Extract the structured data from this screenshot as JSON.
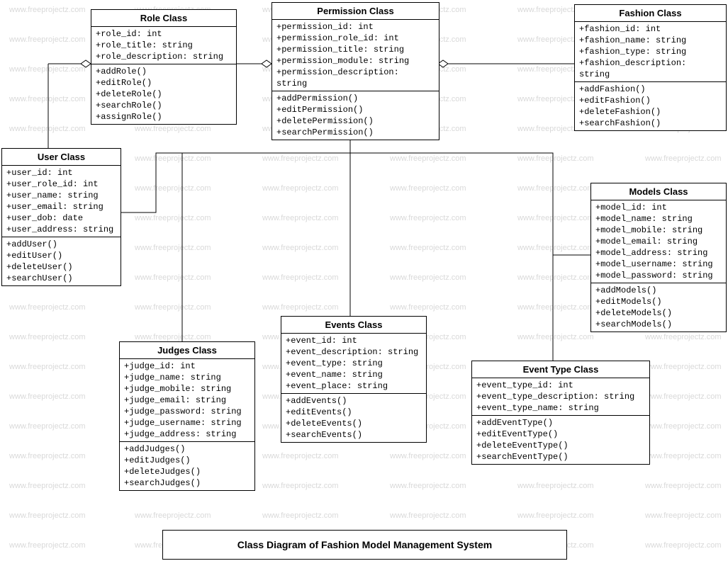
{
  "watermark_text": "www.freeprojectz.com",
  "diagram_title": "Class Diagram of Fashion Model Management System",
  "classes": {
    "role": {
      "title": "Role Class",
      "attrs": [
        "+role_id: int",
        "+role_title: string",
        "+role_description: string"
      ],
      "ops": [
        "+addRole()",
        "+editRole()",
        "+deleteRole()",
        "+searchRole()",
        "+assignRole()"
      ]
    },
    "permission": {
      "title": "Permission Class",
      "attrs": [
        "+permission_id: int",
        "+permission_role_id: int",
        "+permission_title: string",
        "+permission_module: string",
        "+permission_description: string"
      ],
      "ops": [
        "+addPermission()",
        "+editPermission()",
        "+deletePermission()",
        "+searchPermission()"
      ]
    },
    "fashion": {
      "title": "Fashion Class",
      "attrs": [
        "+fashion_id: int",
        "+fashion_name: string",
        "+fashion_type: string",
        "+fashion_description: string"
      ],
      "ops": [
        "+addFashion()",
        "+editFashion()",
        "+deleteFashion()",
        "+searchFashion()"
      ]
    },
    "user": {
      "title": "User Class",
      "attrs": [
        "+user_id: int",
        "+user_role_id: int",
        "+user_name: string",
        "+user_email: string",
        "+user_dob: date",
        "+user_address: string"
      ],
      "ops": [
        "+addUser()",
        "+editUser()",
        "+deleteUser()",
        "+searchUser()"
      ]
    },
    "models": {
      "title": "Models Class",
      "attrs": [
        "+model_id: int",
        "+model_name: string",
        "+model_mobile: string",
        "+model_email: string",
        "+model_address: string",
        "+model_username: string",
        "+model_password: string"
      ],
      "ops": [
        "+addModels()",
        "+editModels()",
        "+deleteModels()",
        "+searchModels()"
      ]
    },
    "judges": {
      "title": "Judges Class",
      "attrs": [
        "+judge_id: int",
        "+judge_name: string",
        "+judge_mobile: string",
        "+judge_email: string",
        "+judge_password: string",
        "+judge_username: string",
        "+judge_address: string"
      ],
      "ops": [
        "+addJudges()",
        "+editJudges()",
        "+deleteJudges()",
        "+searchJudges()"
      ]
    },
    "events": {
      "title": "Events Class",
      "attrs": [
        "+event_id: int",
        "+event_description: string",
        "+event_type: string",
        "+event_name: string",
        "+event_place: string"
      ],
      "ops": [
        "+addEvents()",
        "+editEvents()",
        "+deleteEvents()",
        "+searchEvents()"
      ]
    },
    "eventtype": {
      "title": "Event Type Class",
      "attrs": [
        "+event_type_id: int",
        "+event_type_description: string",
        "+event_type_name: string"
      ],
      "ops": [
        "+addEventType()",
        "+editEventType()",
        "+deleteEventType()",
        "+searchEventType()"
      ]
    }
  }
}
